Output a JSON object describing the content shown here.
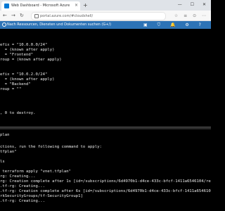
{
  "browser": {
    "tab_title": "Web Dashboard - Microsoft Azure",
    "tab_close": "×",
    "new_tab": "+",
    "window_controls": "—  ☐  ✕",
    "back": "←",
    "forward": "→",
    "refresh": "↻",
    "url": "portal.azure.com/#cloudshell/",
    "toolbar_icons": "☆ ≡ ⊙ ⋯"
  },
  "portal": {
    "search_placeholder": "Nach Ressourcen, Diensten und Dokumenten suchen (G+/)",
    "header_icons": "▣ ⛉ 🔔 ⚙ ? ☺"
  },
  "terminal": {
    "lines": [
      "efix = \"10.0.0.0/24\"",
      "  = (known after apply)",
      "  = \"Frontend\"",
      "roup = (known after apply)",
      "",
      "",
      "efix = \"10.0.2.0/24\"",
      "  = (known after apply)",
      "  = \"Backend\"",
      "roup = \"\"",
      "",
      "",
      "",
      "",
      "",
      "",
      ", 0 to destroy.",
      "",
      "",
      "",
      "plan",
      "",
      "ctions, run the following command to apply:",
      "tfplan\"",
      "",
      "ls",
      "",
      " terraform apply \"vnet.tfplan\"",
      "rg: Creating...",
      "rg: Creation complete after 1s [id=/subscriptions/6d4970b1-d4ce-433c-bfcf-1411a6546104/resourceGroups/",
      ".tf-rg: Creating...",
      ".tf-rg: Creation complete after 6s [id=/subscriptions/6d4970b1-d4ce-433c-bfcf-1411a6546104/resourceGroups",
      "rkSecurityGroups/tf-SecurityGroup1]",
      ".tf-rg: Creating..."
    ]
  }
}
